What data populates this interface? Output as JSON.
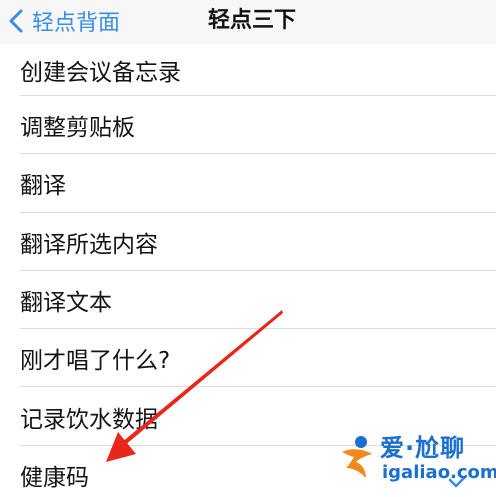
{
  "nav": {
    "back_label": "轻点背面",
    "title": "轻点三下"
  },
  "list": {
    "items": [
      {
        "label": "创建会议备忘录"
      },
      {
        "label": "调整剪贴板"
      },
      {
        "label": "翻译"
      },
      {
        "label": "翻译所选内容"
      },
      {
        "label": "翻译文本"
      },
      {
        "label": "刚才唱了什么?"
      },
      {
        "label": "记录饮水数据"
      },
      {
        "label": "健康码"
      }
    ],
    "selected_index": 7
  },
  "watermark": {
    "cn": "爱·尬聊",
    "en": "igaliao.com"
  },
  "colors": {
    "accent": "#3b8ce8",
    "arrow": "#e8261c",
    "watermark_blue": "#1a6fd0",
    "watermark_orange": "#f08a1c"
  },
  "icons": {
    "back": "chevron-left-icon",
    "selected": "checkmark-icon",
    "annotation": "red-arrow",
    "watermark": "igaliao-logo"
  }
}
